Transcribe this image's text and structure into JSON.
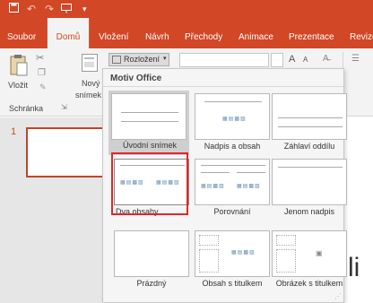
{
  "qat": {
    "undo": "↶",
    "redo": "↷",
    "more": "▾"
  },
  "tabs": [
    {
      "label": "Soubor"
    },
    {
      "label": "Domů"
    },
    {
      "label": "Vložení"
    },
    {
      "label": "Návrh"
    },
    {
      "label": "Přechody"
    },
    {
      "label": "Animace"
    },
    {
      "label": "Prezentace"
    },
    {
      "label": "Revize"
    }
  ],
  "ribbon": {
    "paste_label": "Vložit",
    "new_slide_label_1": "Nový",
    "new_slide_label_2": "snímek",
    "layout_button": "Rozložení",
    "clipboard_group": "Schránka",
    "font_size": "A",
    "font_size_small": "A"
  },
  "gallery": {
    "title": "Motiv Office",
    "layouts": [
      {
        "label": "Úvodní snímek"
      },
      {
        "label": "Nadpis a obsah"
      },
      {
        "label": "Záhlaví oddílu"
      },
      {
        "label": "Dva obsahy"
      },
      {
        "label": "Porovnání"
      },
      {
        "label": "Jenom nadpis"
      },
      {
        "label": "Prázdný"
      },
      {
        "label": "Obsah s titulkem"
      },
      {
        "label": "Obrázek s titulkem"
      }
    ]
  },
  "thumbnail": {
    "number": "1"
  },
  "slide": {
    "visible_text": "li"
  },
  "colors": {
    "accent": "#d24726",
    "highlight": "#e0262e"
  }
}
